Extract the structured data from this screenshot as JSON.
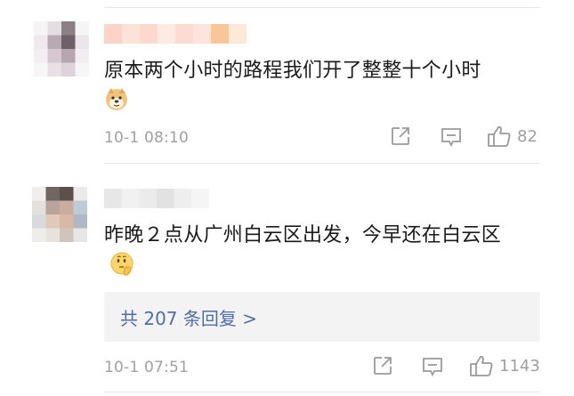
{
  "comments": [
    {
      "text": "原本两个小时的路程我们开了整整十个小时",
      "emoji": "doge-emoji",
      "time": "10-1 08:10",
      "likes": "82"
    },
    {
      "text": "昨晚２点从广州白云区出发，今早还在白云区",
      "emoji": "thinking-emoji",
      "time": "10-1 07:51",
      "likes": "1143",
      "replies_label": "共 207 条回复 >"
    }
  ],
  "icons": {
    "share": "share-icon",
    "comment": "comment-icon",
    "like": "thumbs-up-icon"
  },
  "colors": {
    "text": "#1a1a1a",
    "meta": "#a0a0a0",
    "link": "#4f6ea8",
    "reply_bg": "#f3f3f3"
  }
}
